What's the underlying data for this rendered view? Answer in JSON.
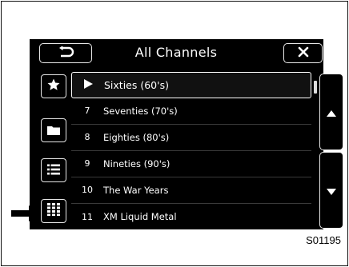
{
  "header": {
    "back_icon": "back-return-icon",
    "title": "All Channels",
    "close_icon": "close-icon"
  },
  "sidebar": {
    "items": [
      {
        "name": "favorites",
        "icon": "star-icon"
      },
      {
        "name": "category",
        "icon": "folder-icon"
      },
      {
        "name": "list",
        "icon": "list-icon"
      },
      {
        "name": "direct-tune",
        "icon": "keypad-icon"
      }
    ]
  },
  "channels": [
    {
      "number": "",
      "name": "Sixties (60's)",
      "selected": true,
      "playing_icon": "play-icon"
    },
    {
      "number": "7",
      "name": "Seventies (70's)",
      "selected": false
    },
    {
      "number": "8",
      "name": "Eighties (80's)",
      "selected": false
    },
    {
      "number": "9",
      "name": "Nineties (90's)",
      "selected": false
    },
    {
      "number": "10",
      "name": "The War Years",
      "selected": false
    },
    {
      "number": "11",
      "name": "XM Liquid Metal",
      "selected": false
    }
  ],
  "pager": {
    "up_icon": "triangle-up-icon",
    "down_icon": "triangle-down-icon"
  },
  "annotation": {
    "pointer_icon": "pointer-arrow-icon",
    "figure_code": "S01195"
  },
  "colors": {
    "screen_background": "#000000",
    "text": "#ffffff",
    "outline": "#e8e8e8"
  }
}
